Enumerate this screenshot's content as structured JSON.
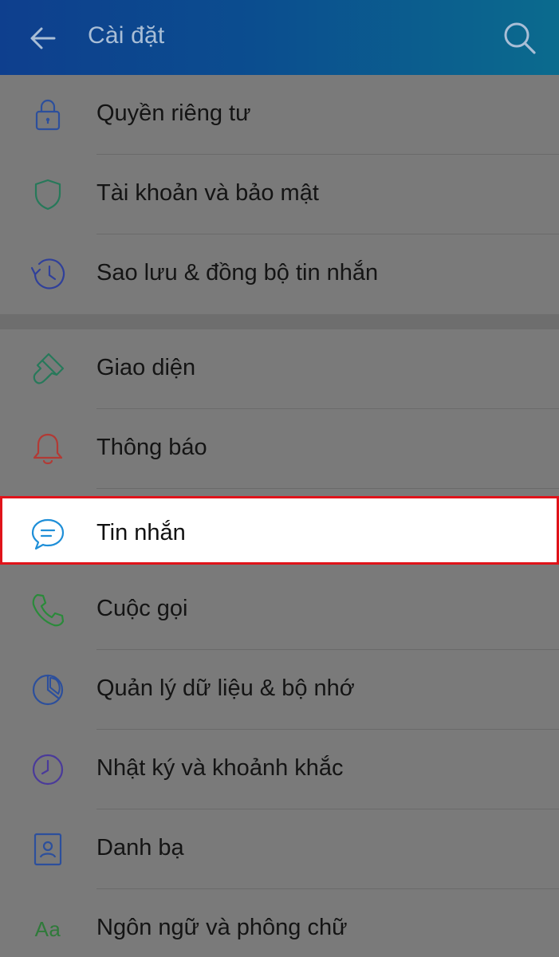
{
  "header": {
    "title": "Cài đặt",
    "back_icon": "arrow-left-icon",
    "search_icon": "search-icon"
  },
  "groups": [
    {
      "items": [
        {
          "label": "Quyền riêng tư",
          "icon": "lock-icon",
          "icon_color": "#2c4f9c"
        },
        {
          "label": "Tài khoản và bảo mật",
          "icon": "shield-icon",
          "icon_color": "#27795a"
        },
        {
          "label": "Sao lưu & đồng bộ tin nhắn",
          "icon": "history-clock-icon",
          "icon_color": "#30409a"
        }
      ]
    },
    {
      "items": [
        {
          "label": "Giao diện",
          "icon": "paint-brush-icon",
          "icon_color": "#27795a"
        },
        {
          "label": "Thông báo",
          "icon": "bell-icon",
          "icon_color": "#b23a35"
        },
        {
          "label": "Tin nhắn",
          "icon": "chat-bubble-icon",
          "icon_color": "#1f8fd8",
          "highlighted": true
        },
        {
          "label": "Cuộc gọi",
          "icon": "phone-icon",
          "icon_color": "#2a8a3a"
        },
        {
          "label": "Quản lý dữ liệu & bộ nhớ",
          "icon": "pie-chart-icon",
          "icon_color": "#2c4f9c"
        },
        {
          "label": "Nhật ký và khoảnh khắc",
          "icon": "clock-icon",
          "icon_color": "#4a3a9a"
        },
        {
          "label": "Danh bạ",
          "icon": "contact-card-icon",
          "icon_color": "#2c4f9c"
        },
        {
          "label": "Ngôn ngữ và phông chữ",
          "icon": "font-aa-icon",
          "icon_text": "Aa",
          "icon_color": "#2f7a3a"
        }
      ]
    }
  ],
  "colors": {
    "header_start": "#0e3f8e",
    "header_end": "#0b6b8e",
    "highlight_border": "#e0131a",
    "overlay_background": "#7a7a7a"
  }
}
